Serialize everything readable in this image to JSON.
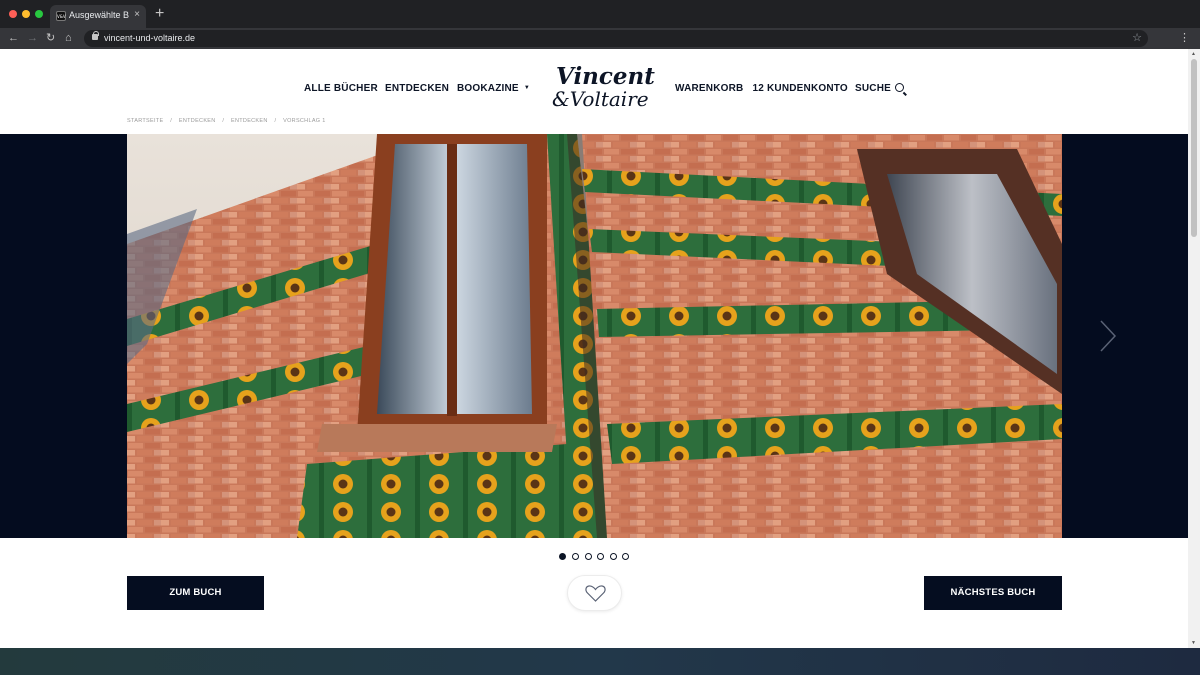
{
  "browser": {
    "tab_title": "Ausgewählte Bücher",
    "tab_favicon": "V&V",
    "tab_close": "×",
    "new_tab": "+",
    "url": "vincent-und-voltaire.de",
    "back": "←",
    "forward": "→",
    "reload": "↻",
    "home": "⌂",
    "star": "☆",
    "menu": "⋮"
  },
  "header": {
    "nav_left": [
      "ALLE BÜCHER",
      "ENTDECKEN",
      "BOOKAZINE"
    ],
    "logo_line1": "Vincent",
    "logo_line2": "&Voltaire",
    "cart_label": "WARENKORB",
    "cart_count": "12",
    "account_label": "KUNDENKONTO",
    "search_label": "SUCHE"
  },
  "breadcrumb": [
    "STARTSEITE",
    "/",
    "ENTDECKEN",
    "/",
    "ENTDECKEN",
    "/",
    "VORSCHLAG 1"
  ],
  "slider": {
    "image_description_icon": "photo-icon",
    "slide_count": 6,
    "active_index": 0
  },
  "actions": {
    "primary_left": "ZUM BUCH",
    "primary_right": "NÄCHSTES BUCH",
    "like_icon": "heart-icon"
  },
  "colors": {
    "brand_navy": "#050d20",
    "slider_bg": "#040c1f"
  }
}
